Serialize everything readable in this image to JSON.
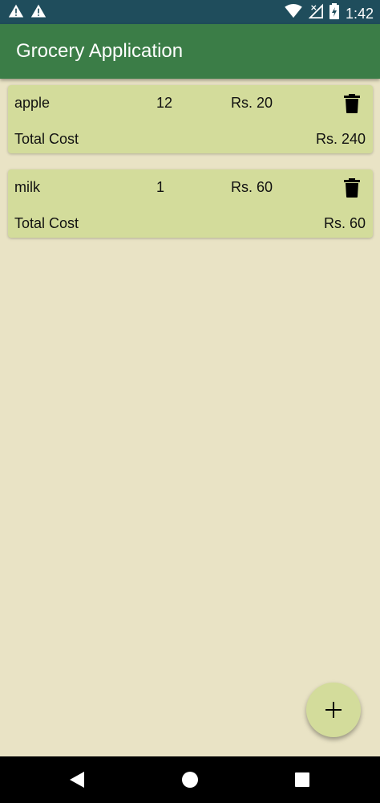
{
  "status_bar": {
    "time": "1:42",
    "icons": [
      "warning-icon",
      "warning-icon",
      "wifi-icon",
      "signal-icon",
      "battery-icon"
    ]
  },
  "app_bar": {
    "title": "Grocery Application"
  },
  "items": [
    {
      "name": "apple",
      "quantity": "12",
      "price": "Rs. 20",
      "total_label": "Total Cost",
      "total_value": "Rs. 240"
    },
    {
      "name": "milk",
      "quantity": "1",
      "price": "Rs. 60",
      "total_label": "Total Cost",
      "total_value": "Rs. 60"
    }
  ],
  "fab": {
    "icon": "plus-icon"
  },
  "nav": {
    "icons": [
      "back-icon",
      "home-icon",
      "recents-icon"
    ]
  },
  "colors": {
    "status_bar": "#1f4d5c",
    "app_bar": "#3b7d47",
    "background": "#e9e3c5",
    "card": "#d3dc9b",
    "nav_bar": "#000000"
  }
}
